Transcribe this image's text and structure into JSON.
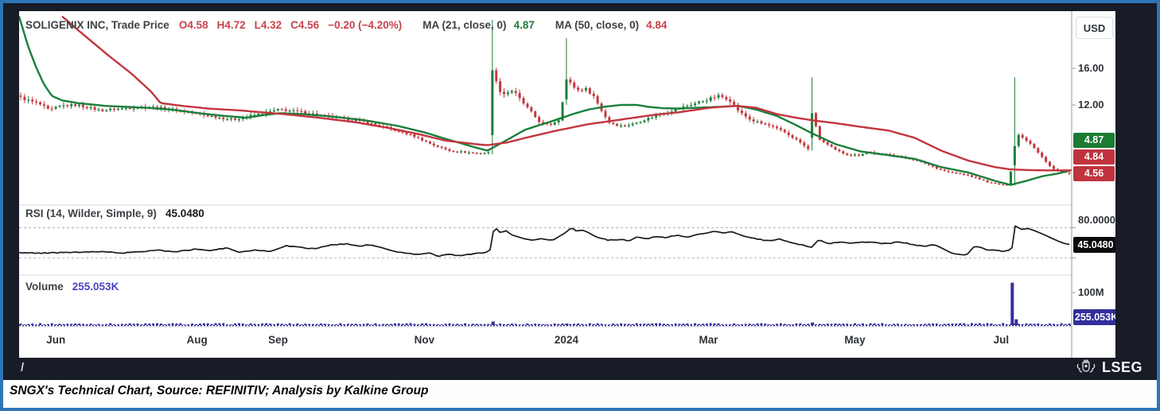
{
  "header": {
    "title": "SOLIGENIX INC, Trade Price",
    "ohlc": [
      "O4.58",
      "H4.72",
      "L4.32",
      "C4.56"
    ],
    "change": "−0.20 (−4.20%)",
    "ma21": {
      "label": "MA (21, close, 0)",
      "value": "4.87"
    },
    "ma50": {
      "label": "MA (50, close, 0)",
      "value": "4.84"
    }
  },
  "rsi_panel": {
    "label": "RSI (14, Wilder, Simple, 9)",
    "value": "45.0480"
  },
  "volume_panel": {
    "label": "Volume",
    "value": "255.053K"
  },
  "y_axis": {
    "currency": "USD",
    "price_ticks": [
      {
        "label": "16.00"
      },
      {
        "label": "12.00"
      }
    ],
    "ma21_badge": "4.87",
    "ma50_badge": "4.84",
    "last_badge": "4.56",
    "rsi_tick": "80.0000",
    "rsi_badge": "45.0480",
    "volume_tick": "100M",
    "volume_badge": "255.053K"
  },
  "footer": {
    "slash": "/",
    "brand": "LSEG"
  },
  "caption": "SNGX's Technical Chart, Source: REFINITIV; Analysis by Kalkine Group",
  "colors": {
    "up": "#1e7e3a",
    "down": "#c2383f",
    "ma21": "#1b7e3c",
    "ma50": "#c2353f",
    "rsi_line": "#17191b",
    "rsi_band": "#b3b3b3",
    "volume": "#332f9e",
    "separator": "#d7d7d7",
    "axis_line": "#9b9b9b",
    "frame_bg": "#171c27",
    "outer_border": "#2e74b6"
  },
  "chart_data": {
    "type": "candlestick+indicators",
    "instrument": "SOLIGENIX INC",
    "last": {
      "open": 4.58,
      "high": 4.72,
      "low": 4.32,
      "close": 4.56,
      "change_pct": -4.2
    },
    "x_axis_labels": [
      {
        "label": "Jun",
        "f": 0.035
      },
      {
        "label": "Aug",
        "f": 0.169
      },
      {
        "label": "Sep",
        "f": 0.246
      },
      {
        "label": "Nov",
        "f": 0.385
      },
      {
        "label": "2024",
        "f": 0.52
      },
      {
        "label": "Mar",
        "f": 0.655
      },
      {
        "label": "May",
        "f": 0.794
      },
      {
        "label": "Jul",
        "f": 0.933
      }
    ],
    "price": {
      "unit": "USD",
      "axis_ticks": [
        16.0,
        12.0
      ],
      "candle_count": 270,
      "close_keyframes": [
        [
          0.0,
          12.8
        ],
        [
          0.0197,
          12.0
        ],
        [
          0.0272,
          11.4
        ],
        [
          0.0386,
          11.9
        ],
        [
          0.0537,
          12.0
        ],
        [
          0.0763,
          11.4
        ],
        [
          0.1028,
          11.7
        ],
        [
          0.1217,
          11.8
        ],
        [
          0.1444,
          11.5
        ],
        [
          0.1746,
          10.9
        ],
        [
          0.2026,
          10.4
        ],
        [
          0.2313,
          11.1
        ],
        [
          0.2479,
          11.5
        ],
        [
          0.2691,
          11.2
        ],
        [
          0.2993,
          10.6
        ],
        [
          0.3258,
          10.2
        ],
        [
          0.3522,
          9.4
        ],
        [
          0.3749,
          8.6
        ],
        [
          0.3938,
          7.6
        ],
        [
          0.4089,
          7.0
        ],
        [
          0.4354,
          6.7
        ],
        [
          0.4475,
          6.8
        ],
        [
          0.4505,
          15.8
        ],
        [
          0.4551,
          13.8
        ],
        [
          0.4604,
          13.2
        ],
        [
          0.4694,
          13.6
        ],
        [
          0.4777,
          12.4
        ],
        [
          0.4868,
          11.2
        ],
        [
          0.4959,
          10.0
        ],
        [
          0.5042,
          9.8
        ],
        [
          0.5133,
          10.4
        ],
        [
          0.5208,
          14.8
        ],
        [
          0.5254,
          14.2
        ],
        [
          0.5314,
          13.6
        ],
        [
          0.5382,
          13.8
        ],
        [
          0.5458,
          13.1
        ],
        [
          0.5533,
          11.5
        ],
        [
          0.5609,
          10.1
        ],
        [
          0.5722,
          9.7
        ],
        [
          0.5836,
          9.9
        ],
        [
          0.5949,
          10.4
        ],
        [
          0.61,
          11.0
        ],
        [
          0.6266,
          11.6
        ],
        [
          0.644,
          12.2
        ],
        [
          0.6659,
          13.0
        ],
        [
          0.6758,
          12.6
        ],
        [
          0.6856,
          11.2
        ],
        [
          0.6969,
          10.3
        ],
        [
          0.712,
          9.8
        ],
        [
          0.7272,
          9.1
        ],
        [
          0.7423,
          8.0
        ],
        [
          0.7513,
          7.1
        ],
        [
          0.7551,
          11.1
        ],
        [
          0.7611,
          8.3
        ],
        [
          0.7687,
          7.7
        ],
        [
          0.7778,
          7.0
        ],
        [
          0.7876,
          6.6
        ],
        [
          0.7989,
          6.5
        ],
        [
          0.808,
          6.9
        ],
        [
          0.8178,
          6.6
        ],
        [
          0.8292,
          6.6
        ],
        [
          0.8405,
          6.3
        ],
        [
          0.8519,
          6.0
        ],
        [
          0.8632,
          5.6
        ],
        [
          0.873,
          5.1
        ],
        [
          0.8836,
          4.7
        ],
        [
          0.8934,
          4.5
        ],
        [
          0.9033,
          4.3
        ],
        [
          0.9138,
          3.9
        ],
        [
          0.9237,
          3.5
        ],
        [
          0.9335,
          3.3
        ],
        [
          0.9426,
          3.2
        ],
        [
          0.9471,
          7.5
        ],
        [
          0.9524,
          8.9
        ],
        [
          0.9577,
          8.2
        ],
        [
          0.963,
          7.8
        ],
        [
          0.969,
          7.0
        ],
        [
          0.9743,
          6.3
        ],
        [
          0.9788,
          5.6
        ],
        [
          0.9841,
          5.0
        ],
        [
          0.9894,
          4.8
        ],
        [
          0.9947,
          4.7
        ],
        [
          1.0,
          4.56
        ]
      ],
      "spikes": [
        {
          "xf": 0.4505,
          "o": 8.7,
          "h": 21.3,
          "l": 6.6,
          "c": 15.8
        },
        {
          "xf": 0.5208,
          "o": 12.6,
          "h": 19.3,
          "l": 12.0,
          "c": 14.8
        },
        {
          "xf": 0.7551,
          "o": 8.4,
          "h": 15.0,
          "l": 7.0,
          "c": 11.1
        },
        {
          "xf": 0.9471,
          "o": 5.4,
          "h": 15.0,
          "l": 3.2,
          "c": 7.5
        },
        {
          "xf": 1.0,
          "o": 4.58,
          "h": 4.72,
          "l": 4.32,
          "c": 4.56
        }
      ]
    },
    "ma21": {
      "value": 4.87,
      "points": [
        [
          0.0,
          21.7
        ],
        [
          0.0083,
          18.5
        ],
        [
          0.0159,
          16.2
        ],
        [
          0.0234,
          14.3
        ],
        [
          0.031,
          13.0
        ],
        [
          0.0408,
          12.5
        ],
        [
          0.0559,
          12.2
        ],
        [
          0.0816,
          11.9
        ],
        [
          0.1194,
          11.7
        ],
        [
          0.1444,
          11.5
        ],
        [
          0.1708,
          11.1
        ],
        [
          0.195,
          10.8
        ],
        [
          0.2162,
          10.6
        ],
        [
          0.2328,
          10.9
        ],
        [
          0.2479,
          11.1
        ],
        [
          0.27,
          11.0
        ],
        [
          0.3,
          10.7
        ],
        [
          0.33,
          10.3
        ],
        [
          0.36,
          9.7
        ],
        [
          0.385,
          9.0
        ],
        [
          0.405,
          8.3
        ],
        [
          0.435,
          7.3
        ],
        [
          0.445,
          7.0
        ],
        [
          0.464,
          8.2
        ],
        [
          0.481,
          9.3
        ],
        [
          0.511,
          10.4
        ],
        [
          0.526,
          11.0
        ],
        [
          0.541,
          11.5
        ],
        [
          0.556,
          11.8
        ],
        [
          0.572,
          12.0
        ],
        [
          0.587,
          12.0
        ],
        [
          0.597,
          11.8
        ],
        [
          0.611,
          11.65
        ],
        [
          0.627,
          11.6
        ],
        [
          0.645,
          11.7
        ],
        [
          0.666,
          11.8
        ],
        [
          0.683,
          11.9
        ],
        [
          0.7,
          11.5
        ],
        [
          0.72,
          10.8
        ],
        [
          0.738,
          9.8
        ],
        [
          0.755,
          8.8
        ],
        [
          0.776,
          7.7
        ],
        [
          0.8,
          6.9
        ],
        [
          0.826,
          6.5
        ],
        [
          0.851,
          6.1
        ],
        [
          0.876,
          5.2
        ],
        [
          0.902,
          4.6
        ],
        [
          0.927,
          3.7
        ],
        [
          0.942,
          3.25
        ],
        [
          0.957,
          3.7
        ],
        [
          0.972,
          4.2
        ],
        [
          0.987,
          4.5
        ],
        [
          1.0,
          4.87
        ]
      ]
    },
    "ma50": {
      "value": 4.84,
      "points": [
        [
          0.0408,
          21.7
        ],
        [
          0.062,
          19.6
        ],
        [
          0.085,
          17.4
        ],
        [
          0.107,
          15.4
        ],
        [
          0.125,
          13.5
        ],
        [
          0.1345,
          12.2
        ],
        [
          0.155,
          11.9
        ],
        [
          0.18,
          11.6
        ],
        [
          0.21,
          11.4
        ],
        [
          0.251,
          11.0
        ],
        [
          0.285,
          10.6
        ],
        [
          0.32,
          10.1
        ],
        [
          0.35,
          9.5
        ],
        [
          0.38,
          8.8
        ],
        [
          0.405,
          8.1
        ],
        [
          0.435,
          7.7
        ],
        [
          0.445,
          7.6
        ],
        [
          0.464,
          7.9
        ],
        [
          0.481,
          8.4
        ],
        [
          0.511,
          9.2
        ],
        [
          0.541,
          9.9
        ],
        [
          0.572,
          10.4
        ],
        [
          0.602,
          10.9
        ],
        [
          0.627,
          11.2
        ],
        [
          0.657,
          11.7
        ],
        [
          0.681,
          11.9
        ],
        [
          0.7,
          11.7
        ],
        [
          0.72,
          11.0
        ],
        [
          0.738,
          10.6
        ],
        [
          0.755,
          10.3
        ],
        [
          0.776,
          10.0
        ],
        [
          0.8,
          9.6
        ],
        [
          0.826,
          9.2
        ],
        [
          0.851,
          8.4
        ],
        [
          0.876,
          7.0
        ],
        [
          0.902,
          5.9
        ],
        [
          0.927,
          5.2
        ],
        [
          0.942,
          4.95
        ],
        [
          0.966,
          4.85
        ],
        [
          1.0,
          4.84
        ]
      ]
    },
    "rsi": {
      "value": 45.048,
      "bands": [
        80,
        20
      ],
      "points": [
        [
          0.0,
          30
        ],
        [
          0.027,
          29.5
        ],
        [
          0.057,
          31
        ],
        [
          0.08,
          33
        ],
        [
          0.095,
          29
        ],
        [
          0.114,
          32
        ],
        [
          0.133,
          35
        ],
        [
          0.148,
          32
        ],
        [
          0.167,
          37
        ],
        [
          0.182,
          34
        ],
        [
          0.197,
          40
        ],
        [
          0.209,
          31
        ],
        [
          0.224,
          36
        ],
        [
          0.239,
          33
        ],
        [
          0.254,
          44
        ],
        [
          0.265,
          41
        ],
        [
          0.28,
          38
        ],
        [
          0.296,
          45
        ],
        [
          0.311,
          48
        ],
        [
          0.322,
          43
        ],
        [
          0.333,
          46
        ],
        [
          0.345,
          40
        ],
        [
          0.356,
          33
        ],
        [
          0.367,
          30
        ],
        [
          0.379,
          26
        ],
        [
          0.39,
          30
        ],
        [
          0.398,
          23
        ],
        [
          0.409,
          27
        ],
        [
          0.42,
          24
        ],
        [
          0.432,
          28
        ],
        [
          0.443,
          30
        ],
        [
          0.449,
          38
        ],
        [
          0.451,
          84
        ],
        [
          0.457,
          70
        ],
        [
          0.462,
          74
        ],
        [
          0.469,
          65
        ],
        [
          0.477,
          60
        ],
        [
          0.485,
          55
        ],
        [
          0.496,
          58
        ],
        [
          0.507,
          55
        ],
        [
          0.519,
          70
        ],
        [
          0.525,
          81
        ],
        [
          0.53,
          73
        ],
        [
          0.534,
          77
        ],
        [
          0.541,
          70
        ],
        [
          0.549,
          61
        ],
        [
          0.56,
          55
        ],
        [
          0.572,
          57
        ],
        [
          0.579,
          54
        ],
        [
          0.587,
          61
        ],
        [
          0.598,
          58
        ],
        [
          0.606,
          63
        ],
        [
          0.613,
          60
        ],
        [
          0.624,
          65
        ],
        [
          0.636,
          62
        ],
        [
          0.647,
          68
        ],
        [
          0.662,
          73
        ],
        [
          0.67,
          70
        ],
        [
          0.677,
          72
        ],
        [
          0.689,
          63
        ],
        [
          0.7,
          58
        ],
        [
          0.711,
          54
        ],
        [
          0.723,
          57
        ],
        [
          0.734,
          50
        ],
        [
          0.745,
          45
        ],
        [
          0.753,
          41
        ],
        [
          0.76,
          57
        ],
        [
          0.768,
          48
        ],
        [
          0.779,
          52
        ],
        [
          0.791,
          49
        ],
        [
          0.802,
          52
        ],
        [
          0.813,
          50
        ],
        [
          0.825,
          48
        ],
        [
          0.836,
          52
        ],
        [
          0.847,
          47
        ],
        [
          0.859,
          43
        ],
        [
          0.87,
          46
        ],
        [
          0.878,
          38
        ],
        [
          0.885,
          30
        ],
        [
          0.893,
          27
        ],
        [
          0.9,
          25
        ],
        [
          0.908,
          44
        ],
        [
          0.915,
          40
        ],
        [
          0.921,
          34
        ],
        [
          0.927,
          36
        ],
        [
          0.933,
          33
        ],
        [
          0.939,
          35
        ],
        [
          0.943,
          35
        ],
        [
          0.946,
          84
        ],
        [
          0.953,
          76
        ],
        [
          0.958,
          79
        ],
        [
          0.965,
          74
        ],
        [
          0.974,
          66
        ],
        [
          0.983,
          57
        ],
        [
          0.991,
          50
        ],
        [
          1.0,
          45.05
        ]
      ]
    },
    "volume": {
      "latest_label": "255.053K",
      "axis_tick": {
        "label": "100M",
        "millions": 100
      },
      "bars": [
        {
          "xf": 0.4505,
          "millions": 11
        },
        {
          "xf": 0.5208,
          "millions": 5
        },
        {
          "xf": 0.7551,
          "millions": 8
        },
        {
          "xf": 0.9456,
          "millions": 130
        },
        {
          "xf": 0.9494,
          "millions": 18
        }
      ]
    }
  }
}
